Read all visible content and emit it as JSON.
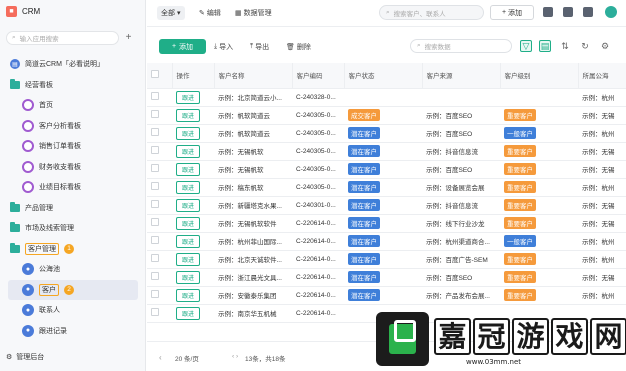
{
  "app": {
    "logo_glyph": "■",
    "title": "CRM"
  },
  "sidebar": {
    "search_placeholder": "输入应用搜索",
    "add_label": "+",
    "items": [
      {
        "label": "简道云CRM「必看说明」",
        "icon": "doc-icon",
        "level": 0
      },
      {
        "label": "经营看板",
        "icon": "folder-icon",
        "level": 0
      },
      {
        "label": "首页",
        "icon": "dashboard-icon",
        "level": 1
      },
      {
        "label": "客户分析看板",
        "icon": "dashboard-icon",
        "level": 1
      },
      {
        "label": "销售订单看板",
        "icon": "dashboard-icon",
        "level": 1
      },
      {
        "label": "财务收支看板",
        "icon": "dashboard-icon",
        "level": 1
      },
      {
        "label": "业绩目标看板",
        "icon": "dashboard-icon",
        "level": 1
      },
      {
        "label": "产品管理",
        "icon": "folder-icon",
        "level": 0
      },
      {
        "label": "市场及线索管理",
        "icon": "folder-icon",
        "level": 0
      },
      {
        "label": "客户管理",
        "icon": "folder-icon",
        "level": 0,
        "badge": "1"
      },
      {
        "label": "公海池",
        "icon": "person-icon",
        "level": 1
      },
      {
        "label": "客户",
        "icon": "person-icon",
        "level": 1,
        "badge": "2",
        "selected": true
      },
      {
        "label": "联系人",
        "icon": "person-icon",
        "level": 1
      },
      {
        "label": "跟进记录",
        "icon": "person-icon",
        "level": 1
      }
    ],
    "footer_label": "管理后台"
  },
  "topbar": {
    "scope_label": "全部",
    "edit_label": "编辑",
    "data_manage_label": "数据管理",
    "search_placeholder": "搜索客户、联系人",
    "add_label": "添加"
  },
  "toolbar": {
    "new_label": "添加",
    "import_label": "导入",
    "export_label": "导出",
    "delete_label": "删除",
    "search_placeholder": "搜索数据"
  },
  "table": {
    "columns": [
      "",
      "操作",
      "客户名称",
      "客户编码",
      "客户状态",
      "客户来源",
      "客户级别",
      "所属公海"
    ],
    "action_label": "跟进",
    "rows": [
      [
        "示例：北京简道云小...",
        "C-240328-0...",
        "",
        "",
        "",
        "示例：杭州"
      ],
      [
        "示例：帆软简道云",
        "C-240305-0...",
        "成交客户",
        "示例：百度SEO",
        "重要客户",
        "示例：无锡"
      ],
      [
        "示例：帆软简道云",
        "C-240305-0...",
        "潜在客户",
        "示例：百度SEO",
        "一般客户",
        "示例：杭州"
      ],
      [
        "示例：无锡帆软",
        "C-240305-0...",
        "潜在客户",
        "示例：抖音信息流",
        "重要客户",
        "示例：无锡"
      ],
      [
        "示例：无锡帆软",
        "C-240305-0...",
        "潜在客户",
        "示例：百度SEO",
        "重要客户",
        "示例：无锡"
      ],
      [
        "示例：稿东帆软",
        "C-240305-0...",
        "潜在客户",
        "示例：设备展览会展",
        "重要客户",
        "示例：杭州"
      ],
      [
        "示例：新疆塔克水果...",
        "C-240301-0...",
        "潜在客户",
        "示例：抖音信息流",
        "重要客户",
        "示例：无锡"
      ],
      [
        "示例：无锡帆软软件",
        "C-220614-0...",
        "潜在客户",
        "示例：线下行业沙龙",
        "重要客户",
        "示例：无锡"
      ],
      [
        "示例：杭州菲山国际...",
        "C-220614-0...",
        "潜在客户",
        "示例：杭州渠道商合...",
        "一般客户",
        "示例：杭州"
      ],
      [
        "示例：北京天诚软件...",
        "C-220614-0...",
        "潜在客户",
        "示例：百度广告-SEM",
        "重要客户",
        "示例：杭州"
      ],
      [
        "示例：浙江晨光文具...",
        "C-220614-0...",
        "潜在客户",
        "示例：百度SEO",
        "重要客户",
        "示例：无锡"
      ],
      [
        "示例：安徽泰乐集团",
        "C-220614-0...",
        "潜在客户",
        "示例：产品发布会展...",
        "重要客户",
        "示例：杭州"
      ],
      [
        "示例：南京华五机械",
        "C-220614-0...",
        "",
        "",
        "",
        ""
      ]
    ]
  },
  "pager": {
    "size_label": "20 条/页",
    "prev_next": "‹ ›",
    "total_label": "13条，共18条"
  },
  "watermark": {
    "chars": [
      "嘉",
      "冠",
      "游",
      "戏",
      "网"
    ],
    "url": "www.03mm.net"
  },
  "colors": {
    "accent": "#1fae88",
    "status_blue": "#3f7fd9",
    "status_orange": "#f59a3c",
    "highlight": "#f5a623"
  }
}
